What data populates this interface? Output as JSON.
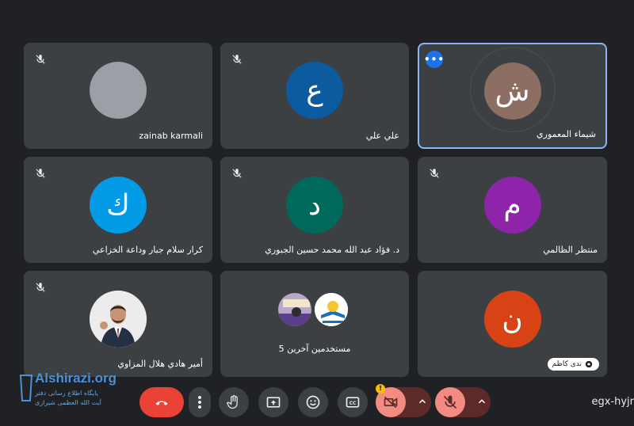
{
  "participants": [
    {
      "name": "zainab karmali",
      "initial": "",
      "color": "#9aa0a6",
      "muted": true
    },
    {
      "name": "علي علي",
      "initial": "ع",
      "color": "#0b5ba1",
      "muted": true
    },
    {
      "name": "شيماء المعموري",
      "initial": "ش",
      "color": "#8d6e63",
      "muted": false,
      "active": true
    },
    {
      "name": "كرار سلام جبار وداعة الخزاعي",
      "initial": "ك",
      "color": "#039be5",
      "muted": true
    },
    {
      "name": "د. فؤاد عبد الله محمد حسين الجبوري",
      "initial": "د",
      "color": "#00695c",
      "muted": true
    },
    {
      "name": "منتظر الظالمي",
      "initial": "م",
      "color": "#8e24aa",
      "muted": true
    },
    {
      "name": "أمير هادي هلال المزاوي",
      "initial": "",
      "color": "#e0e0e0",
      "muted": true,
      "photo": true
    },
    {
      "name": "5 مستخدمين آخرين",
      "initial": "",
      "color": "",
      "muted": false,
      "others": true
    },
    {
      "name": "ندى كاظم",
      "initial": "ن",
      "color": "#d84315",
      "muted": false
    }
  ],
  "meeting_code": "egx-hyjr",
  "watermark": {
    "title": "Alshirazi.org",
    "line1": "پایگاه اطلاع رسانی دفتر",
    "line2": "آیت الله العظمی شیرازی"
  },
  "colors": {
    "background": "#202124",
    "tile": "#3c4043",
    "active_border": "#8ab4f8",
    "end_call": "#ea4335",
    "muted_control": "#f28b82",
    "warning": "#fbbc04"
  },
  "icons": {
    "mic_off": "mic-off-icon",
    "end_call": "end-call-icon",
    "more": "more-vert-icon",
    "raise_hand": "raise-hand-icon",
    "present": "present-screen-icon",
    "emoji": "emoji-icon",
    "captions": "captions-icon",
    "camera_off": "camera-off-icon",
    "chevron": "chevron-up-icon"
  }
}
